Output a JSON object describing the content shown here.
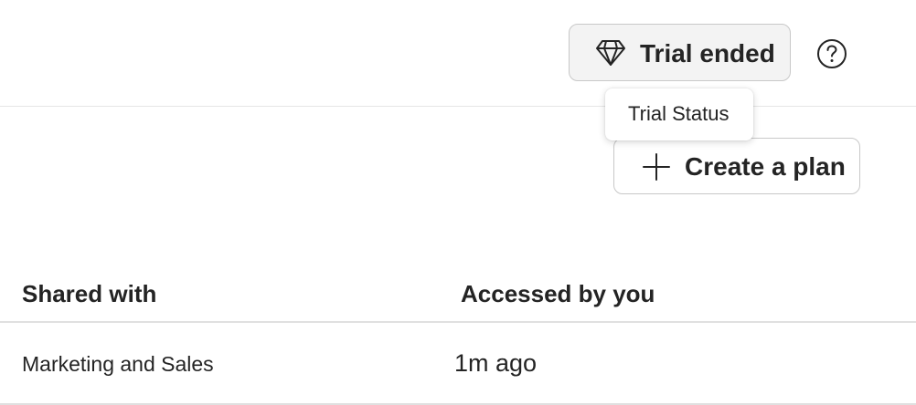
{
  "header": {
    "trial_label": "Trial ended",
    "trial_icon": "diamond-icon",
    "help_icon": "question-circle-icon",
    "tooltip": "Trial Status"
  },
  "toolbar": {
    "create_label": "Create a plan",
    "create_icon": "plus-icon"
  },
  "table": {
    "columns": [
      "Shared with",
      "Accessed by you"
    ],
    "rows": [
      {
        "shared_with": "Marketing and Sales",
        "accessed": "1m ago"
      }
    ]
  }
}
